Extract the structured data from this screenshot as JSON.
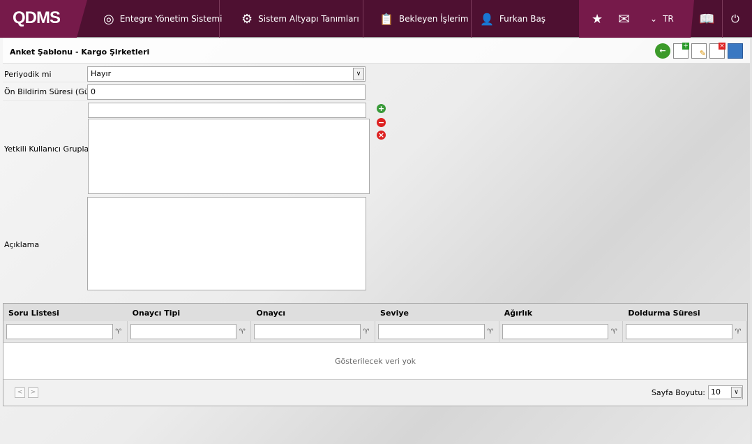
{
  "header": {
    "logo": "QDMS",
    "nav": [
      "Entegre Yönetim Sistemi",
      "Sistem Altyapı Tanımları",
      "Bekleyen İşlerim",
      "Furkan Baş"
    ],
    "lang": "TR"
  },
  "page": {
    "title": "Anket Şablonu - Kargo Şirketleri"
  },
  "form": {
    "periodic_label": "Periyodik mi",
    "periodic_value": "Hayır",
    "notice_label": "Ön Bildirim Süresi (Gün)",
    "notice_value": "0",
    "groups_label": "Yetkili Kullanıcı Grupları",
    "desc_label": "Açıklama"
  },
  "grid": {
    "columns": [
      "Soru Listesi",
      "Onaycı Tipi",
      "Onaycı",
      "Seviye",
      "Ağırlık",
      "Doldurma Süresi"
    ],
    "empty": "Gösterilecek veri yok",
    "page_size_label": "Sayfa Boyutu:",
    "page_size": "10"
  }
}
